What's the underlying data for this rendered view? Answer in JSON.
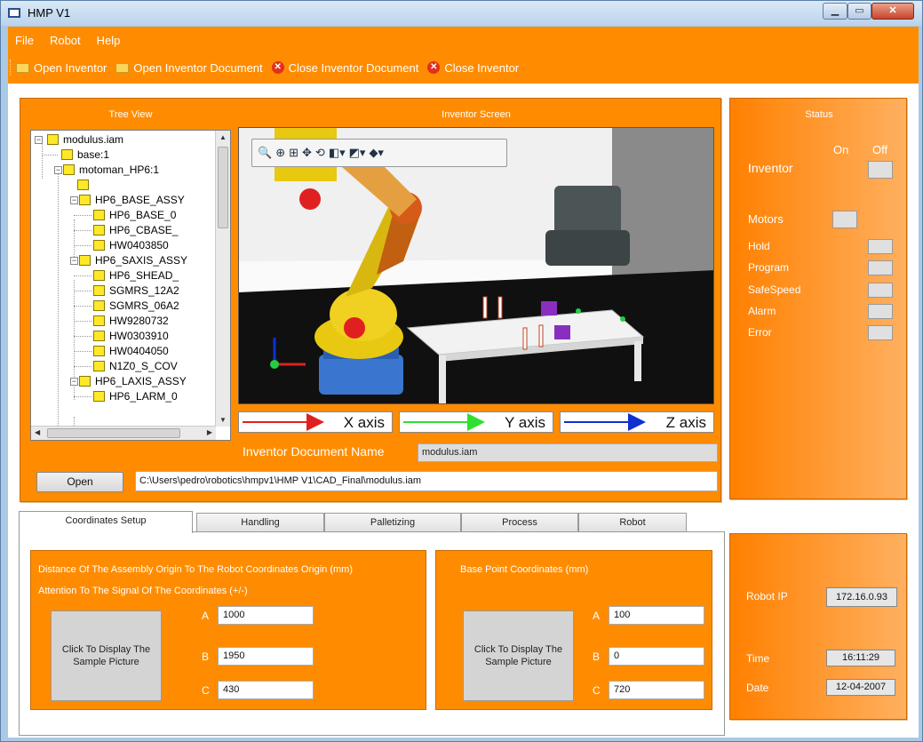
{
  "window": {
    "title": "HMP V1",
    "min_glyph": "▁",
    "max_glyph": "▭",
    "close_glyph": "✕"
  },
  "menu": [
    "File",
    "Robot",
    "Help"
  ],
  "toolbar": {
    "open_inventor": "Open Inventor",
    "open_document": "Open Inventor Document",
    "close_document": "Close Inventor Document",
    "close_inventor": "Close Inventor",
    "close_icon_glyph": "✕"
  },
  "main": {
    "tree_title": "Tree View",
    "screen_title": "Inventor Screen",
    "tree": [
      "modulus.iam",
      "base:1",
      "motoman_HP6:1",
      "",
      "HP6_BASE_ASSY",
      "HP6_BASE_0",
      "HP6_CBASE_",
      "HW0403850",
      "HP6_SAXIS_ASSY",
      "HP6_SHEAD_",
      "SGMRS_12A2",
      "SGMRS_06A2",
      "HW9280732",
      "HW0303910",
      "HW0404050",
      "N1Z0_S_COV",
      "HP6_LAXIS_ASSY",
      "HP6_LARM_0"
    ],
    "axes": {
      "x": "X axis",
      "y": "Y axis",
      "z": "Z axis"
    },
    "doc_name_label": "Inventor Document Name",
    "doc_name_value": "modulus.iam",
    "open_button": "Open",
    "path": "C:\\Users\\pedro\\robotics\\hmpv1\\HMP V1\\CAD_Final\\modulus.iam"
  },
  "status": {
    "title": "Status",
    "on": "On",
    "off": "Off",
    "inventor": "Inventor",
    "motors": "Motors",
    "items": [
      "Hold",
      "Program",
      "SafeSpeed",
      "Alarm",
      "Error"
    ]
  },
  "info": {
    "robot_ip_label": "Robot IP",
    "robot_ip": "172.16.0.93",
    "time_label": "Time",
    "time": "16:11:29",
    "date_label": "Date",
    "date": "12-04-2007"
  },
  "tabs": [
    "Coordinates Setup",
    "Handling",
    "Palletizing",
    "Process",
    "Robot"
  ],
  "coords": {
    "dist_title": "Distance Of The Assembly Origin To The Robot Coordinates Origin (mm)",
    "attention": "Attention To The Signal Of The Coordinates (+/-)",
    "picture_button": "Click To Display The Sample Picture",
    "labels": [
      "A",
      "B",
      "C"
    ],
    "dist_values": [
      "1000",
      "1950",
      "430"
    ],
    "base_title": "Base Point Coordinates (mm)",
    "base_values": [
      "100",
      "0",
      "720"
    ]
  },
  "colors": {
    "accent": "#ff8c00",
    "x_axis": "#e02020",
    "y_axis": "#30e030",
    "z_axis": "#1030d0"
  }
}
